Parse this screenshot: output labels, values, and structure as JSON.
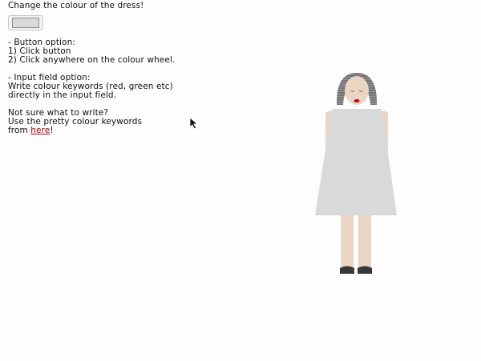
{
  "title": "Change the colour of the dress!",
  "button_section": {
    "heading": "- Button option:",
    "step1": "1) Click button",
    "step2": "2) Click anywhere on the colour wheel."
  },
  "input_section": {
    "heading": "- Input field option:",
    "line1": "Write colour keywords (red, green etc)",
    "line2": "directly in the input field."
  },
  "help_section": {
    "line1": "Not sure what to write?",
    "line2": "Use the pretty colour keywords",
    "line3_prefix": "from ",
    "link_text": "here",
    "line3_suffix": "!"
  },
  "dress_color": "#d9d9d9",
  "colors": {
    "skin": "#ead4c2",
    "hair": "#7b7b7b",
    "hair_stroke": "#9c9c9c",
    "lips": "#d10016",
    "shoes": "#383838",
    "link": "#b10000"
  },
  "icons": {
    "cursor": "pointer-cursor-icon"
  }
}
